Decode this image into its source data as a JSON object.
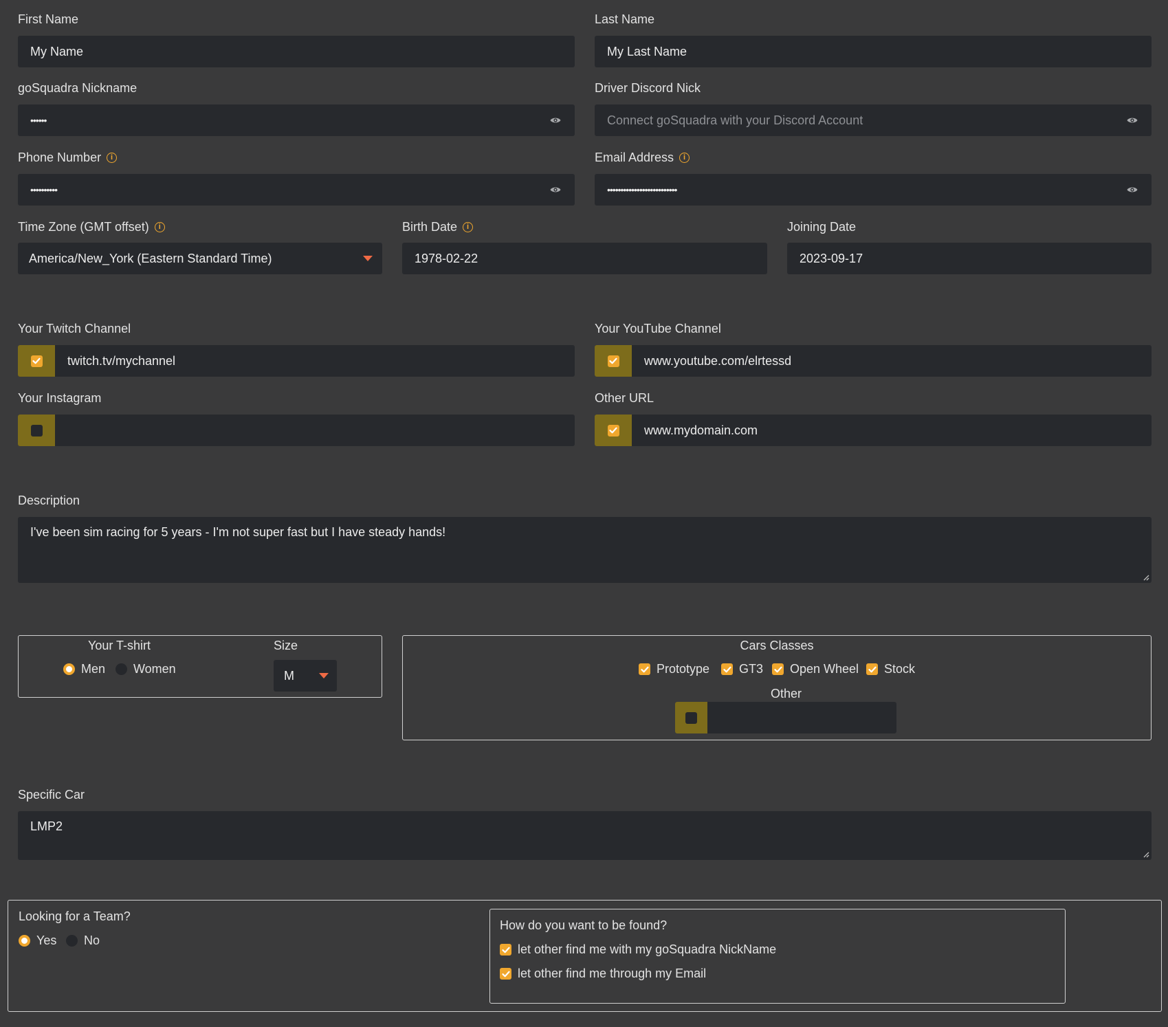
{
  "profile": {
    "first_name": {
      "label": "First Name",
      "value": "My Name"
    },
    "last_name": {
      "label": "Last Name",
      "value": "My Last Name"
    },
    "nickname": {
      "label": "goSquadra Nickname",
      "value": "••••••"
    },
    "discord": {
      "label": "Driver Discord Nick",
      "placeholder": "Connect goSquadra with your Discord Account"
    },
    "phone": {
      "label": "Phone Number",
      "value": "••••••••••"
    },
    "email": {
      "label": "Email Address",
      "value": "••••••••••••••••••••••••••"
    },
    "timezone": {
      "label": "Time Zone (GMT offset)",
      "value": "America/New_York (Eastern Standard Time)"
    },
    "birth_date": {
      "label": "Birth Date",
      "value": "1978-02-22"
    },
    "joining_date": {
      "label": "Joining Date",
      "value": "2023-09-17"
    }
  },
  "channels": {
    "twitch": {
      "label": "Your Twitch Channel",
      "value": "twitch.tv/mychannel",
      "checked": true
    },
    "youtube": {
      "label": "Your YouTube Channel",
      "value": "www.youtube.com/elrtessd",
      "checked": true
    },
    "instagram": {
      "label": "Your Instagram",
      "value": "",
      "checked": false
    },
    "other": {
      "label": "Other URL",
      "value": "www.mydomain.com",
      "checked": true
    }
  },
  "description": {
    "label": "Description",
    "value": "I've been sim racing for 5 years - I'm not super fast but I have steady hands!"
  },
  "tshirt": {
    "title": "Your T-shirt",
    "options": [
      {
        "label": "Men",
        "selected": true
      },
      {
        "label": "Women",
        "selected": false
      }
    ],
    "size_label": "Size",
    "size_value": "M"
  },
  "car_classes": {
    "title": "Cars Classes",
    "options": [
      {
        "label": "Prototype",
        "checked": true
      },
      {
        "label": "GT3",
        "checked": true
      },
      {
        "label": "Open Wheel",
        "checked": true
      },
      {
        "label": "Stock",
        "checked": true
      }
    ],
    "other_label": "Other",
    "other_checked": false
  },
  "specific_car": {
    "label": "Specific Car",
    "value": "LMP2"
  },
  "team": {
    "title": "Looking for a Team?",
    "options": [
      {
        "label": "Yes",
        "selected": true
      },
      {
        "label": "No",
        "selected": false
      }
    ],
    "found_title": "How do you want to be found?",
    "found_options": [
      {
        "label": "let other find me with my goSquadra NickName",
        "checked": true
      },
      {
        "label": "let other find me through my Email",
        "checked": true
      }
    ]
  },
  "colors": {
    "background": "#3a3a3b",
    "field": "#27292d",
    "accent": "#f0a72e",
    "checkbox_bg": "#7d6c1b",
    "chevron": "#ef6a45"
  }
}
